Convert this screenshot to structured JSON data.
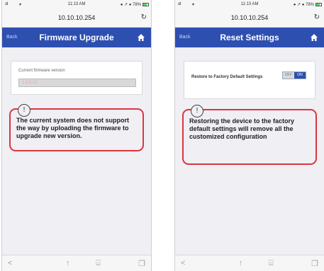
{
  "left": {
    "status": {
      "signal": "ull",
      "wifi": "▾",
      "time": "11:13 AM",
      "battery": "● ↗ ● 78%"
    },
    "url": "10.10.10.254",
    "reload_icon": "↻",
    "nav": {
      "back": "Back",
      "title": "Firmware Upgrade"
    },
    "card": {
      "label": "Current firmware version",
      "value": "1.0.0.10"
    },
    "warning": {
      "icon": "!",
      "message": "The current system does not support the way by uploading the firmware to upgrade new version."
    },
    "toolbar": {
      "back": "<",
      "share": "↑",
      "bookmarks": "⌸",
      "tabs": "❐"
    }
  },
  "right": {
    "status": {
      "signal": "ull",
      "wifi": "▾",
      "time": "11:13 AM",
      "battery": "● ↗ ● 78%"
    },
    "url": "10.10.10.254",
    "reload_icon": "↻",
    "nav": {
      "back": "Back",
      "title": "Reset Settings"
    },
    "card": {
      "label": "Restore to Factory Default Settings",
      "toggle_off": "OFF",
      "toggle_on": "ON"
    },
    "warning": {
      "icon": "!",
      "message": "Restoring the device to the factory default settings will remove all the customized configuration"
    },
    "toolbar": {
      "back": "<",
      "share": "↑",
      "bookmarks": "⌸",
      "tabs": "❐"
    }
  }
}
